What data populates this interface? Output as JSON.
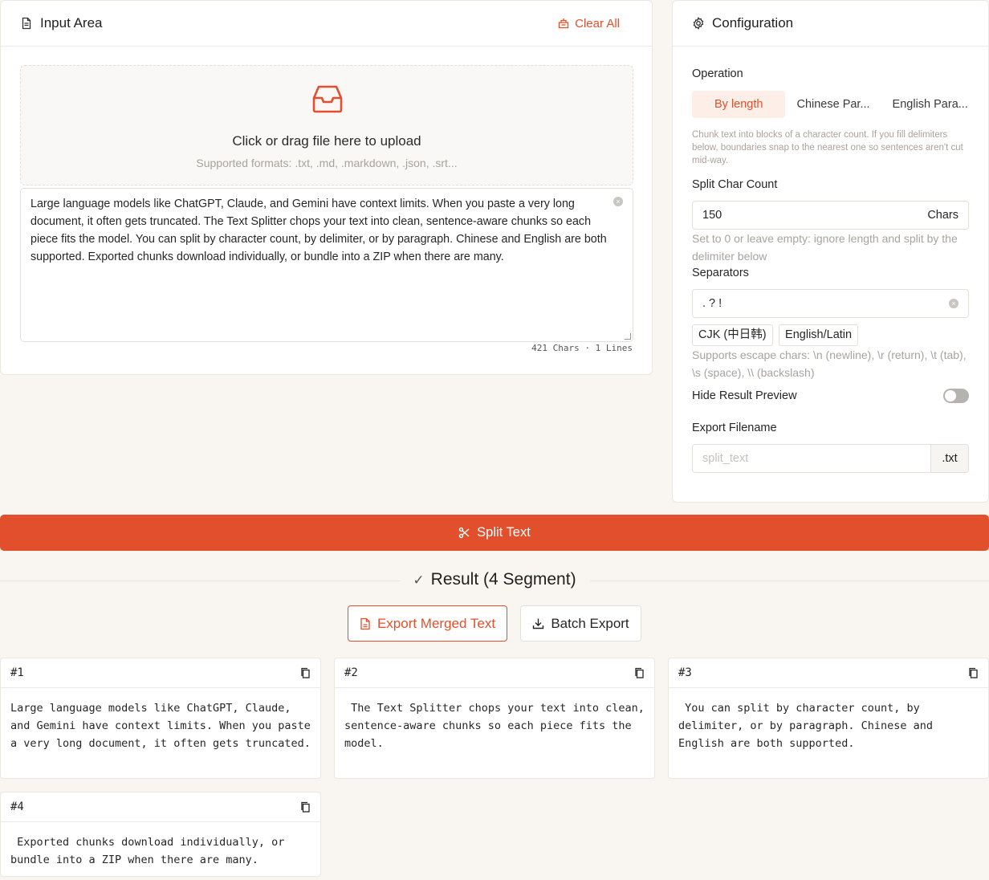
{
  "input": {
    "title": "Input Area",
    "clear_all": "Clear All",
    "upload_title": "Click or drag file here to upload",
    "upload_formats": "Supported formats: .txt, .md, .markdown, .json, .srt...",
    "text": "Large language models like ChatGPT, Claude, and Gemini have context limits. When you paste a very long document, it often gets truncated. The Text Splitter chops your text into clean, sentence-aware chunks so each piece fits the model. You can split by character count, by delimiter, or by paragraph. Chinese and English are both supported. Exported chunks download individually, or bundle into a ZIP when there are many.",
    "counter": "421 Chars · 1 Lines"
  },
  "config": {
    "title": "Configuration",
    "operation_label": "Operation",
    "operations": [
      "By length",
      "Chinese Par...",
      "English Para..."
    ],
    "operation_help": "Chunk text into blocks of a character count. If you fill delimiters below, boundaries snap to the nearest one so sentences aren't cut mid-way.",
    "split_count_label": "Split Char Count",
    "split_count_value": "150",
    "split_count_unit": "Chars",
    "split_count_help": "Set to 0 or leave empty: ignore length and split by the delimiter below",
    "separators_label": "Separators",
    "separators_value": ". ? !",
    "presets": [
      "CJK (中日韩)",
      "English/Latin"
    ],
    "escape_help": "Supports escape chars: \\n (newline), \\r (return), \\t (tab), \\s (space), \\\\ (backslash)",
    "hide_preview_label": "Hide Result Preview",
    "hide_preview_on": false,
    "filename_label": "Export Filename",
    "filename_placeholder": "split_text",
    "filename_ext": ".txt"
  },
  "split_button": "Split Text",
  "result": {
    "title": "Result (4 Segment)",
    "export_merged": "Export Merged Text",
    "batch_export": "Batch Export",
    "segments": [
      {
        "id": "#1",
        "text": "Large language models like ChatGPT, Claude, and Gemini have context limits. When you paste a very long document, it often gets truncated."
      },
      {
        "id": "#2",
        "text": " The Text Splitter chops your text into clean, sentence-aware chunks so each piece fits the model."
      },
      {
        "id": "#3",
        "text": " You can split by character count, by delimiter, or by paragraph. Chinese and English are both supported."
      },
      {
        "id": "#4",
        "text": " Exported chunks download individually, or bundle into a ZIP when there are many."
      }
    ]
  },
  "colors": {
    "accent": "#e24f2d",
    "background": "#f9f6f1"
  }
}
